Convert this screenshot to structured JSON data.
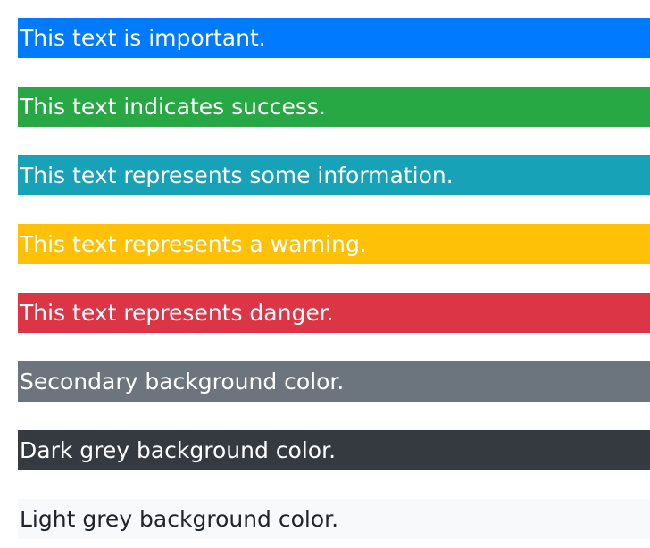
{
  "rows": [
    {
      "text": "This text is important.",
      "background": "#007bff",
      "color": "#ffffff"
    },
    {
      "text": "This text indicates success.",
      "background": "#28a745",
      "color": "#ffffff"
    },
    {
      "text": "This text represents some information.",
      "background": "#17a2b8",
      "color": "#ffffff"
    },
    {
      "text": "This text represents a warning.",
      "background": "#ffc107",
      "color": "#ffffff"
    },
    {
      "text": "This text represents danger.",
      "background": "#dc3545",
      "color": "#ffffff"
    },
    {
      "text": "Secondary background color.",
      "background": "#6c757d",
      "color": "#ffffff"
    },
    {
      "text": "Dark grey background color.",
      "background": "#343a40",
      "color": "#ffffff"
    },
    {
      "text": "Light grey background color.",
      "background": "#f8f9fa",
      "color": "#212529"
    }
  ]
}
